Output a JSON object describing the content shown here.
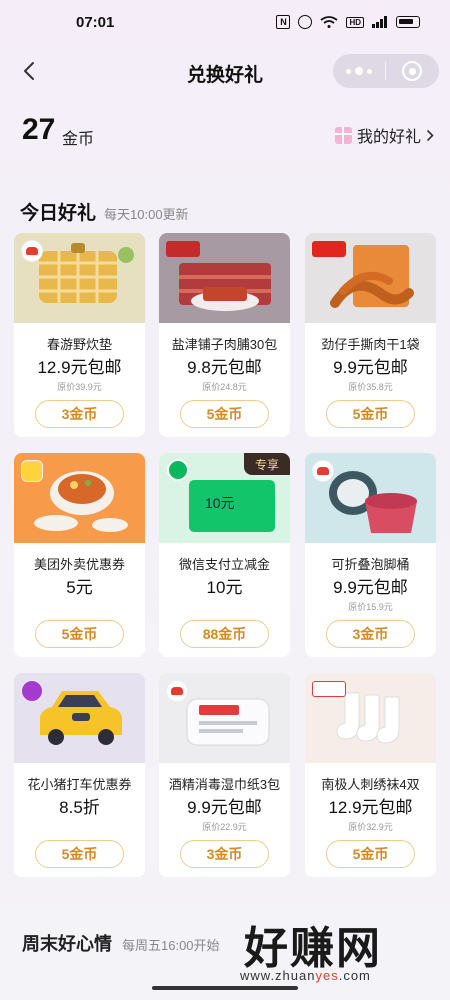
{
  "status_bar": {
    "time": "07:01",
    "nfc": "N",
    "hd": "HD",
    "network": "4G"
  },
  "nav": {
    "title": "兑换好礼"
  },
  "coins": {
    "amount": "27",
    "unit": "金币",
    "my_gifts_label": "我的好礼"
  },
  "section": {
    "title": "今日好礼",
    "subtitle": "每天10:00更新"
  },
  "items": [
    {
      "name": "春游野炊垫",
      "price": "12.9元包邮",
      "original": "原价39.9元",
      "cost": "3金币",
      "image_color": "#e6dfc0",
      "icon": "picnic-mat-image"
    },
    {
      "name": "盐津铺子肉脯30包",
      "price": "9.8元包邮",
      "original": "原价24.8元",
      "cost": "5金币",
      "image_color": "#a79aa3",
      "icon": "jerky-image"
    },
    {
      "name": "劲仔手撕肉干1袋",
      "price": "9.9元包邮",
      "original": "原价35.8元",
      "cost": "5金币",
      "image_color": "#e4e2e3",
      "icon": "shredded-jerky-image"
    },
    {
      "name": "美团外卖优惠券",
      "price": "5元",
      "original": "",
      "cost": "5金币",
      "image_color": "#f79a4a",
      "icon": "food-delivery-image"
    },
    {
      "name": "微信支付立减金",
      "price": "10元",
      "original": "",
      "cost": "88金币",
      "image_color": "#d9f3e4",
      "icon": "wechat-pay-image",
      "tag": "专享",
      "card_label": "10元"
    },
    {
      "name": "可折叠泡脚桶",
      "price": "9.9元包邮",
      "original": "原价15.9元",
      "cost": "3金币",
      "image_color": "#cfe6ea",
      "icon": "foot-bucket-image"
    },
    {
      "name": "花小猪打车优惠券",
      "price": "8.5折",
      "original": "",
      "cost": "5金币",
      "image_color": "#e5e1ef",
      "icon": "taxi-car-image"
    },
    {
      "name": "酒精消毒湿巾纸3包",
      "price": "9.9元包邮",
      "original": "原价22.9元",
      "cost": "3金币",
      "image_color": "#ededf0",
      "icon": "wet-wipes-image"
    },
    {
      "name": "南极人刺绣袜4双",
      "price": "12.9元包邮",
      "original": "原价32.9元",
      "cost": "5金币",
      "image_color": "#f6ede8",
      "icon": "socks-image"
    }
  ],
  "weekend": {
    "title": "周末好心情",
    "subtitle": "每周五16:00开始"
  },
  "watermark": {
    "text": "好赚网",
    "url_prefix": "www.zhuan",
    "url_highlight": "yes",
    "url_suffix": ".com"
  }
}
